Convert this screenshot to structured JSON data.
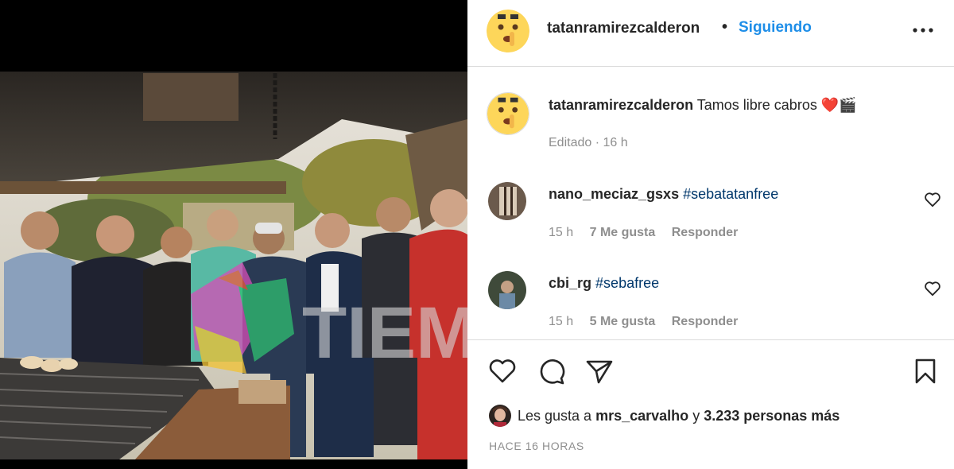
{
  "post": {
    "username": "tatanramirezcalderon",
    "dot": "•",
    "follow_label": "Siguiendo",
    "caption_text": "Tamos libre cabros",
    "caption_emoji": "❤️🎬",
    "edited_label": "Editado · 16 h",
    "photo_watermark": "TIEMPOX"
  },
  "comments": [
    {
      "username": "nano_meciaz_gsxs",
      "hashtag": "#sebatatanfree",
      "time": "15 h",
      "likes": "7 Me gusta",
      "reply_label": "Responder"
    },
    {
      "username": "cbi_rg",
      "hashtag": "#sebafree",
      "time": "15 h",
      "likes": "5 Me gusta",
      "reply_label": "Responder"
    }
  ],
  "likes_line": {
    "prefix": "Les gusta a",
    "user": "mrs_carvalho",
    "connector": "y",
    "others": "3.233 personas más"
  },
  "time_ago": "HACE 16 HORAS",
  "icons": {
    "more": "more-horizontal-icon",
    "like": "heart-outline-icon",
    "comment": "comment-bubble-icon",
    "share": "paper-plane-icon",
    "save": "bookmark-outline-icon"
  },
  "colors": {
    "follow_blue": "#1e8ee8",
    "hashtag_blue": "#00376b",
    "muted_gray": "#8e8e8e",
    "divider": "#dbdbdb"
  }
}
